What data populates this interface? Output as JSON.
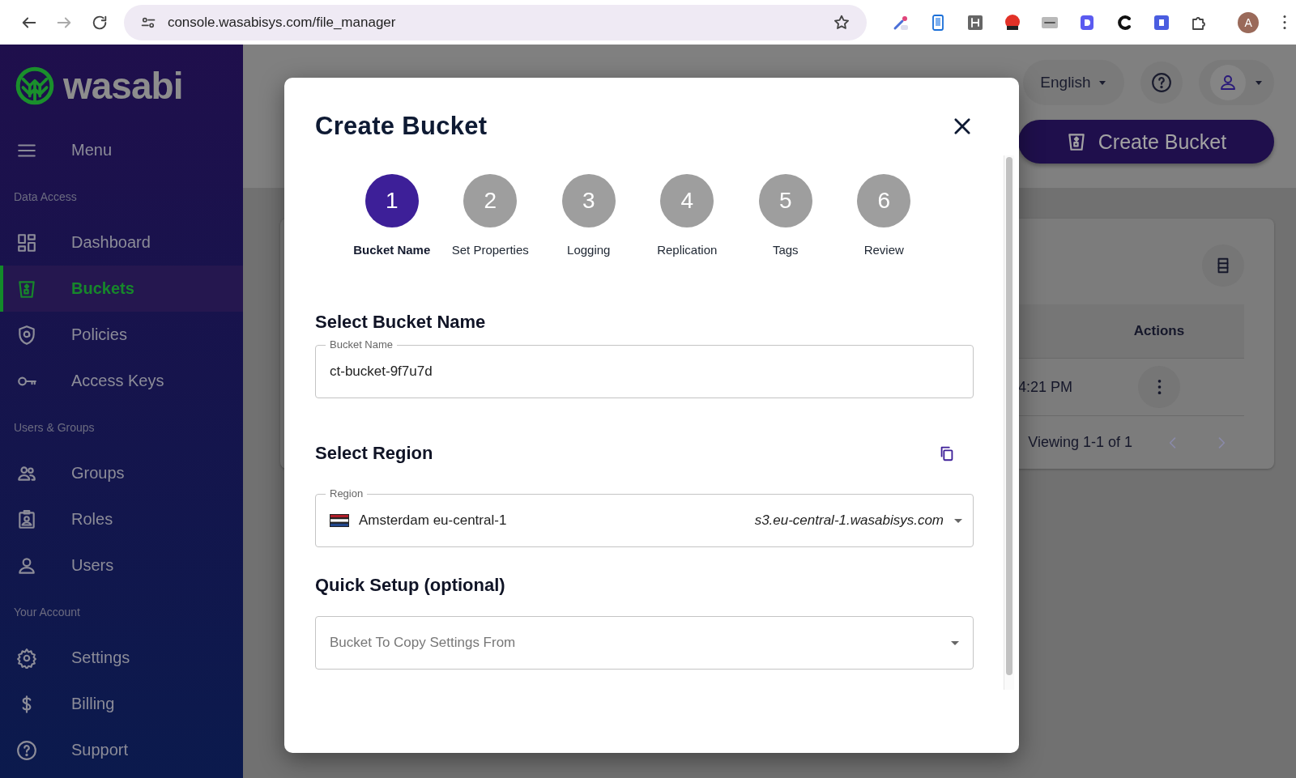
{
  "browser": {
    "url": "console.wasabisys.com/file_manager",
    "profile_initial": "A"
  },
  "sidebar": {
    "logo": "wasabi",
    "menu_label": "Menu",
    "sections": [
      {
        "title": "Data Access",
        "items": [
          {
            "label": "Dashboard",
            "selected": false
          },
          {
            "label": "Buckets",
            "selected": true
          },
          {
            "label": "Policies",
            "selected": false
          },
          {
            "label": "Access Keys",
            "selected": false
          }
        ]
      },
      {
        "title": "Users & Groups",
        "items": [
          {
            "label": "Groups",
            "selected": false
          },
          {
            "label": "Roles",
            "selected": false
          },
          {
            "label": "Users",
            "selected": false
          }
        ]
      },
      {
        "title": "Your Account",
        "items": [
          {
            "label": "Settings",
            "selected": false
          },
          {
            "label": "Billing",
            "selected": false
          },
          {
            "label": "Support",
            "selected": false
          }
        ]
      }
    ]
  },
  "header": {
    "language": "English",
    "create_button": "Create Bucket"
  },
  "buckets_table": {
    "columns": [
      "Actions"
    ],
    "rows": [
      {
        "column_1": "4:21 PM"
      }
    ],
    "pagination": "Viewing 1-1 of 1"
  },
  "modal": {
    "title": "Create Bucket",
    "steps": [
      {
        "number": "1",
        "label": "Bucket Name",
        "selected": true
      },
      {
        "number": "2",
        "label": "Set Properties",
        "selected": false
      },
      {
        "number": "3",
        "label": "Logging",
        "selected": false
      },
      {
        "number": "4",
        "label": "Replication",
        "selected": false
      },
      {
        "number": "5",
        "label": "Tags",
        "selected": false
      },
      {
        "number": "6",
        "label": "Review",
        "selected": false
      }
    ],
    "bucket_name": {
      "heading": "Select Bucket Name",
      "label": "Bucket Name",
      "value": "ct-bucket-9f7u7d"
    },
    "region": {
      "heading": "Select Region",
      "label": "Region",
      "name": "Amsterdam eu-central-1",
      "endpoint": "s3.eu-central-1.wasabisys.com"
    },
    "quick_setup": {
      "heading": "Quick Setup (optional)",
      "placeholder": "Bucket To Copy Settings From"
    }
  }
}
